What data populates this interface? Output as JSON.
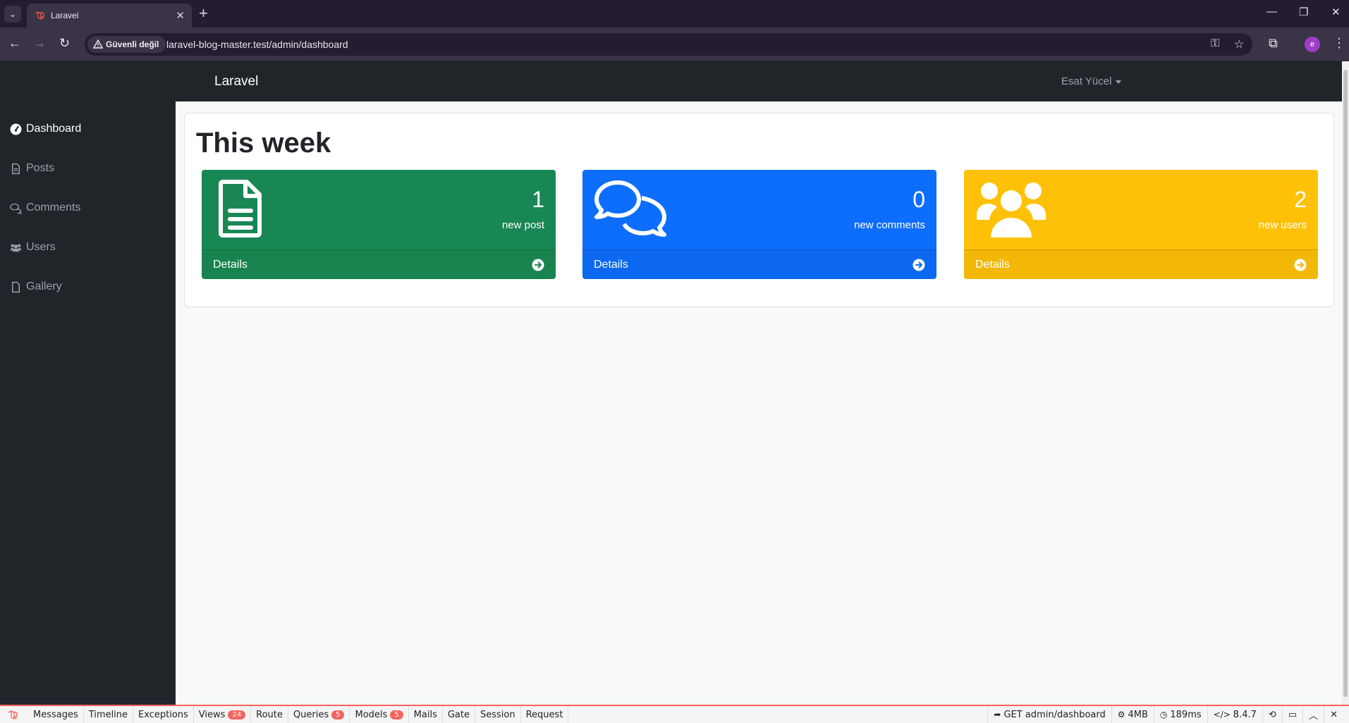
{
  "browser": {
    "tab_title": "Laravel",
    "security_label": "Güvenli değil",
    "url": "laravel-blog-master.test/admin/dashboard",
    "profile_initial": "e"
  },
  "app": {
    "brand": "Laravel",
    "user_name": "Esat Yücel"
  },
  "sidebar": {
    "items": [
      {
        "label": "Dashboard",
        "icon": "dashboard-gauge-icon",
        "active": true
      },
      {
        "label": "Posts",
        "icon": "file-icon",
        "active": false
      },
      {
        "label": "Comments",
        "icon": "comments-icon",
        "active": false
      },
      {
        "label": "Users",
        "icon": "users-icon",
        "active": false
      },
      {
        "label": "Gallery",
        "icon": "file-icon",
        "active": false
      }
    ]
  },
  "main": {
    "title": "This week",
    "stats": [
      {
        "value": "1",
        "label": "new post",
        "details": "Details",
        "icon": "file-lines-icon",
        "color": "#198754",
        "foot_color": "#18834f"
      },
      {
        "value": "0",
        "label": "new comments",
        "details": "Details",
        "icon": "comments-icon",
        "color": "#0d6efd",
        "foot_color": "#0c68f0"
      },
      {
        "value": "2",
        "label": "new users",
        "details": "Details",
        "icon": "users-icon",
        "color": "#ffc107",
        "foot_color": "#f3b807"
      }
    ]
  },
  "debugbar": {
    "tabs": [
      {
        "label": "Messages"
      },
      {
        "label": "Timeline"
      },
      {
        "label": "Exceptions"
      },
      {
        "label": "Views",
        "badge": "24"
      },
      {
        "label": "Route"
      },
      {
        "label": "Queries",
        "badge": "5"
      },
      {
        "label": "Models",
        "badge": "5"
      },
      {
        "label": "Mails"
      },
      {
        "label": "Gate"
      },
      {
        "label": "Session"
      },
      {
        "label": "Request"
      }
    ],
    "request": "GET admin/dashboard",
    "memory": "4MB",
    "time": "189ms",
    "php_version": "8.4.7"
  }
}
